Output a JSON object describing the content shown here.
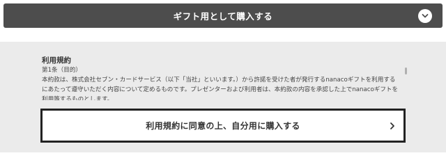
{
  "gift_section": {
    "label": "ギフト用として購入する",
    "toggle_icon": "chevron-down-icon"
  },
  "terms": {
    "heading": "利用規約",
    "article_title": "第1条（目的）",
    "article_body": "本約款は、株式会社セブン・カードサービス（以下「当社」といいます。）から許諾を受けた者が発行するnanacoギフトを利用するにあたって遵守いただく内容について定めるものです。プレゼンターおよび利用者は、本約款の内容を承認した上でnanacoギフトを利用等するものとします。"
  },
  "self_purchase": {
    "label": "利用規約に同意の上、自分用に購入する",
    "icon": "chevron-right-icon"
  },
  "colors": {
    "bar_background": "#4d4d4d",
    "panel_background": "#ebebeb",
    "button_border": "#222222"
  }
}
